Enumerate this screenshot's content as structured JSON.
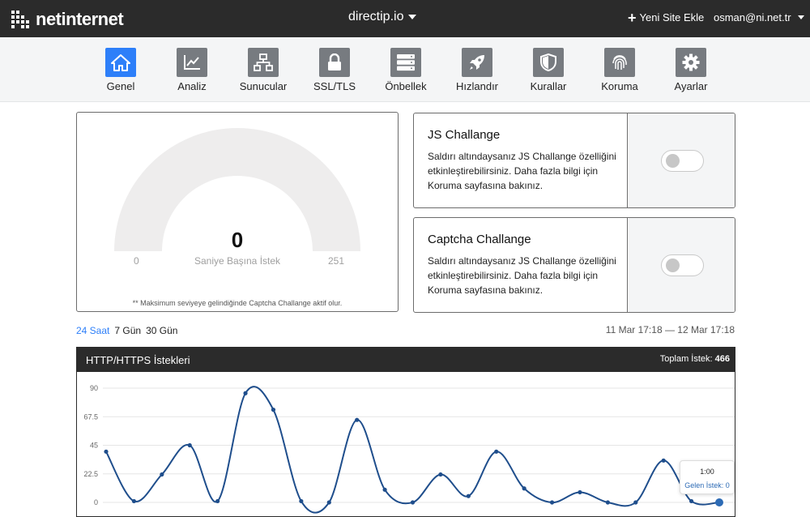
{
  "topbar": {
    "logo_text": "netinternet",
    "site": "directip.io",
    "add_site": "Yeni Site Ekle",
    "user": "osman@ni.net.tr"
  },
  "nav": [
    {
      "label": "Genel",
      "icon": "home-icon",
      "active": true
    },
    {
      "label": "Analiz",
      "icon": "chart-icon",
      "active": false
    },
    {
      "label": "Sunucular",
      "icon": "network-icon",
      "active": false
    },
    {
      "label": "SSL/TLS",
      "icon": "lock-icon",
      "active": false
    },
    {
      "label": "Önbellek",
      "icon": "server-icon",
      "active": false
    },
    {
      "label": "Hızlandır",
      "icon": "rocket-icon",
      "active": false
    },
    {
      "label": "Kurallar",
      "icon": "shield-icon",
      "active": false
    },
    {
      "label": "Koruma",
      "icon": "fingerprint-icon",
      "active": false
    },
    {
      "label": "Ayarlar",
      "icon": "gear-icon",
      "active": false
    }
  ],
  "gauge": {
    "value": "0",
    "label": "Saniye Başına İstek",
    "min": "0",
    "max": "251",
    "note": "** Maksimum seviyeye gelindiğinde Captcha Challange aktif olur.",
    "level": 0
  },
  "js_challenge": {
    "title": "JS Challange",
    "description": "Saldırı altındaysanız JS Challange özelliğini etkinleştirebilirsiniz. Daha fazla bilgi için Koruma sayfasına bakınız.",
    "enabled": false
  },
  "captcha_challenge": {
    "title": "Captcha Challange",
    "description": "Saldırı altındaysanız JS Challange özelliğini etkinleştirebilirsiniz. Daha fazla bilgi için Koruma sayfasına bakınız.",
    "enabled": false
  },
  "range": {
    "tabs": [
      {
        "label": "24 Saat",
        "active": true
      },
      {
        "label": "7 Gün",
        "active": false
      },
      {
        "label": "30 Gün",
        "active": false
      }
    ],
    "dates": "11 Mar 17:18 — 12 Mar 17:18"
  },
  "chart": {
    "title": "HTTP/HTTPS İstekleri",
    "total_label": "Toplam İstek:",
    "total_value": "466",
    "tooltip_time": "1:00",
    "tooltip_value": "Gelen İstek: 0"
  },
  "colors": {
    "accent": "#2d7ff9",
    "topbar": "#2b2b2b",
    "line": "#1f4e8c"
  },
  "chart_data": {
    "type": "line",
    "y_ticks": [
      "90",
      "67.5",
      "45",
      "22.5",
      "0"
    ],
    "ylim": [
      0,
      90
    ],
    "grid": true,
    "series": [
      {
        "values": [
          40,
          1,
          22,
          45,
          1,
          86,
          73,
          1,
          0,
          65,
          10,
          0,
          22,
          5,
          40,
          11,
          0,
          8,
          0,
          0,
          33,
          1,
          0
        ]
      }
    ]
  }
}
